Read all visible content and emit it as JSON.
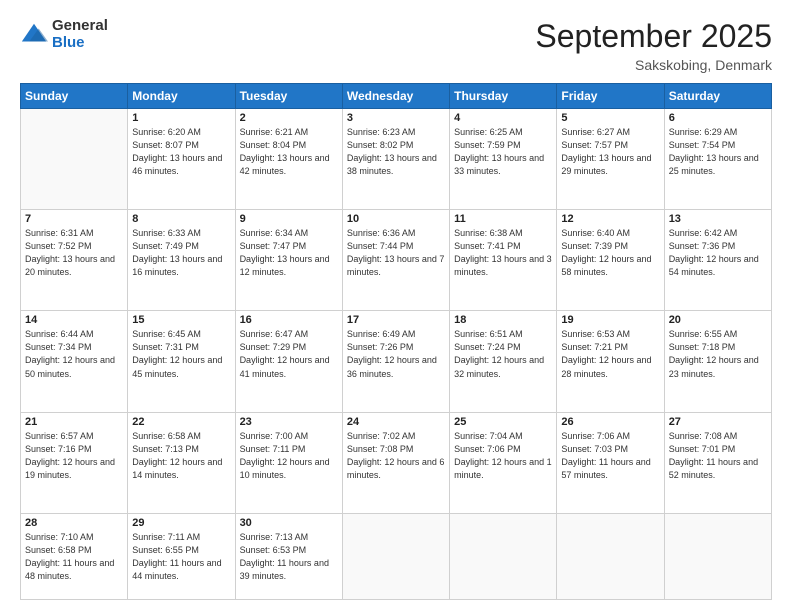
{
  "logo": {
    "general": "General",
    "blue": "Blue"
  },
  "header": {
    "month": "September 2025",
    "location": "Sakskobing, Denmark"
  },
  "days_of_week": [
    "Sunday",
    "Monday",
    "Tuesday",
    "Wednesday",
    "Thursday",
    "Friday",
    "Saturday"
  ],
  "weeks": [
    [
      {
        "day": "",
        "sunrise": "",
        "sunset": "",
        "daylight": ""
      },
      {
        "day": "1",
        "sunrise": "Sunrise: 6:20 AM",
        "sunset": "Sunset: 8:07 PM",
        "daylight": "Daylight: 13 hours and 46 minutes."
      },
      {
        "day": "2",
        "sunrise": "Sunrise: 6:21 AM",
        "sunset": "Sunset: 8:04 PM",
        "daylight": "Daylight: 13 hours and 42 minutes."
      },
      {
        "day": "3",
        "sunrise": "Sunrise: 6:23 AM",
        "sunset": "Sunset: 8:02 PM",
        "daylight": "Daylight: 13 hours and 38 minutes."
      },
      {
        "day": "4",
        "sunrise": "Sunrise: 6:25 AM",
        "sunset": "Sunset: 7:59 PM",
        "daylight": "Daylight: 13 hours and 33 minutes."
      },
      {
        "day": "5",
        "sunrise": "Sunrise: 6:27 AM",
        "sunset": "Sunset: 7:57 PM",
        "daylight": "Daylight: 13 hours and 29 minutes."
      },
      {
        "day": "6",
        "sunrise": "Sunrise: 6:29 AM",
        "sunset": "Sunset: 7:54 PM",
        "daylight": "Daylight: 13 hours and 25 minutes."
      }
    ],
    [
      {
        "day": "7",
        "sunrise": "Sunrise: 6:31 AM",
        "sunset": "Sunset: 7:52 PM",
        "daylight": "Daylight: 13 hours and 20 minutes."
      },
      {
        "day": "8",
        "sunrise": "Sunrise: 6:33 AM",
        "sunset": "Sunset: 7:49 PM",
        "daylight": "Daylight: 13 hours and 16 minutes."
      },
      {
        "day": "9",
        "sunrise": "Sunrise: 6:34 AM",
        "sunset": "Sunset: 7:47 PM",
        "daylight": "Daylight: 13 hours and 12 minutes."
      },
      {
        "day": "10",
        "sunrise": "Sunrise: 6:36 AM",
        "sunset": "Sunset: 7:44 PM",
        "daylight": "Daylight: 13 hours and 7 minutes."
      },
      {
        "day": "11",
        "sunrise": "Sunrise: 6:38 AM",
        "sunset": "Sunset: 7:41 PM",
        "daylight": "Daylight: 13 hours and 3 minutes."
      },
      {
        "day": "12",
        "sunrise": "Sunrise: 6:40 AM",
        "sunset": "Sunset: 7:39 PM",
        "daylight": "Daylight: 12 hours and 58 minutes."
      },
      {
        "day": "13",
        "sunrise": "Sunrise: 6:42 AM",
        "sunset": "Sunset: 7:36 PM",
        "daylight": "Daylight: 12 hours and 54 minutes."
      }
    ],
    [
      {
        "day": "14",
        "sunrise": "Sunrise: 6:44 AM",
        "sunset": "Sunset: 7:34 PM",
        "daylight": "Daylight: 12 hours and 50 minutes."
      },
      {
        "day": "15",
        "sunrise": "Sunrise: 6:45 AM",
        "sunset": "Sunset: 7:31 PM",
        "daylight": "Daylight: 12 hours and 45 minutes."
      },
      {
        "day": "16",
        "sunrise": "Sunrise: 6:47 AM",
        "sunset": "Sunset: 7:29 PM",
        "daylight": "Daylight: 12 hours and 41 minutes."
      },
      {
        "day": "17",
        "sunrise": "Sunrise: 6:49 AM",
        "sunset": "Sunset: 7:26 PM",
        "daylight": "Daylight: 12 hours and 36 minutes."
      },
      {
        "day": "18",
        "sunrise": "Sunrise: 6:51 AM",
        "sunset": "Sunset: 7:24 PM",
        "daylight": "Daylight: 12 hours and 32 minutes."
      },
      {
        "day": "19",
        "sunrise": "Sunrise: 6:53 AM",
        "sunset": "Sunset: 7:21 PM",
        "daylight": "Daylight: 12 hours and 28 minutes."
      },
      {
        "day": "20",
        "sunrise": "Sunrise: 6:55 AM",
        "sunset": "Sunset: 7:18 PM",
        "daylight": "Daylight: 12 hours and 23 minutes."
      }
    ],
    [
      {
        "day": "21",
        "sunrise": "Sunrise: 6:57 AM",
        "sunset": "Sunset: 7:16 PM",
        "daylight": "Daylight: 12 hours and 19 minutes."
      },
      {
        "day": "22",
        "sunrise": "Sunrise: 6:58 AM",
        "sunset": "Sunset: 7:13 PM",
        "daylight": "Daylight: 12 hours and 14 minutes."
      },
      {
        "day": "23",
        "sunrise": "Sunrise: 7:00 AM",
        "sunset": "Sunset: 7:11 PM",
        "daylight": "Daylight: 12 hours and 10 minutes."
      },
      {
        "day": "24",
        "sunrise": "Sunrise: 7:02 AM",
        "sunset": "Sunset: 7:08 PM",
        "daylight": "Daylight: 12 hours and 6 minutes."
      },
      {
        "day": "25",
        "sunrise": "Sunrise: 7:04 AM",
        "sunset": "Sunset: 7:06 PM",
        "daylight": "Daylight: 12 hours and 1 minute."
      },
      {
        "day": "26",
        "sunrise": "Sunrise: 7:06 AM",
        "sunset": "Sunset: 7:03 PM",
        "daylight": "Daylight: 11 hours and 57 minutes."
      },
      {
        "day": "27",
        "sunrise": "Sunrise: 7:08 AM",
        "sunset": "Sunset: 7:01 PM",
        "daylight": "Daylight: 11 hours and 52 minutes."
      }
    ],
    [
      {
        "day": "28",
        "sunrise": "Sunrise: 7:10 AM",
        "sunset": "Sunset: 6:58 PM",
        "daylight": "Daylight: 11 hours and 48 minutes."
      },
      {
        "day": "29",
        "sunrise": "Sunrise: 7:11 AM",
        "sunset": "Sunset: 6:55 PM",
        "daylight": "Daylight: 11 hours and 44 minutes."
      },
      {
        "day": "30",
        "sunrise": "Sunrise: 7:13 AM",
        "sunset": "Sunset: 6:53 PM",
        "daylight": "Daylight: 11 hours and 39 minutes."
      },
      {
        "day": "",
        "sunrise": "",
        "sunset": "",
        "daylight": ""
      },
      {
        "day": "",
        "sunrise": "",
        "sunset": "",
        "daylight": ""
      },
      {
        "day": "",
        "sunrise": "",
        "sunset": "",
        "daylight": ""
      },
      {
        "day": "",
        "sunrise": "",
        "sunset": "",
        "daylight": ""
      }
    ]
  ]
}
